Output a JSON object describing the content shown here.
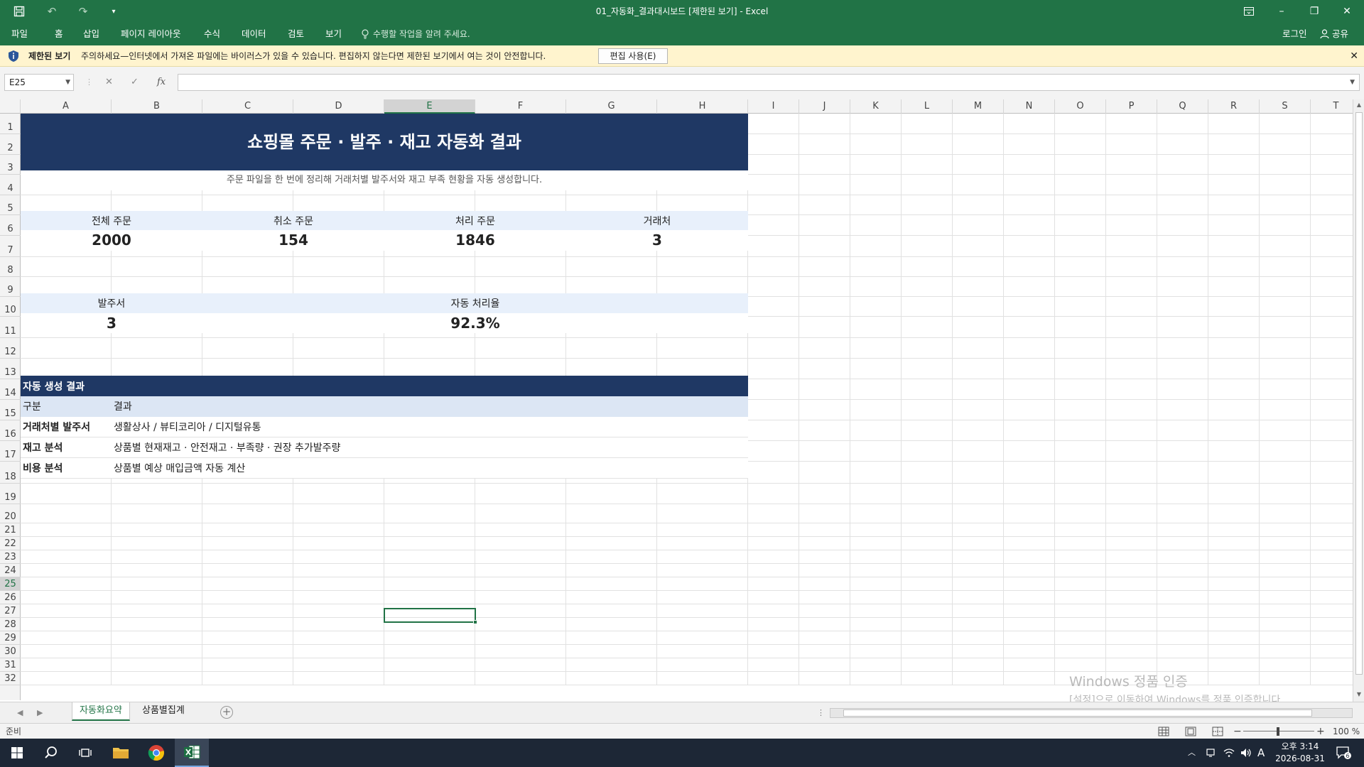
{
  "window": {
    "title": "01_자동화_결과대시보드  [제한된 보기] - Excel",
    "minimize": "–",
    "restore": "❐",
    "close": "✕"
  },
  "menu": {
    "items": [
      "파일",
      "홈",
      "삽입",
      "페이지 레이아웃",
      "수식",
      "데이터",
      "검토",
      "보기"
    ],
    "tell_me": "수행할 작업을 알려 주세요.",
    "login": "로그인",
    "share": "공유"
  },
  "protected_view": {
    "title": "제한된 보기",
    "message": "주의하세요—인터넷에서 가져온 파일에는 바이러스가 있을 수 있습니다. 편집하지 않는다면 제한된 보기에서 여는 것이 안전합니다.",
    "button": "편집 사용(E)",
    "close": "✕"
  },
  "formula_bar": {
    "name_box": "E25",
    "cancel": "✕",
    "enter": "✓",
    "fx": "fx",
    "value": ""
  },
  "columns": [
    "A",
    "B",
    "C",
    "D",
    "E",
    "F",
    "G",
    "H",
    "I",
    "J",
    "K",
    "L",
    "M",
    "N",
    "O",
    "P",
    "Q",
    "R",
    "S",
    "T"
  ],
  "selected_column": "E",
  "selected_row": "25",
  "rows": [
    "1",
    "2",
    "3",
    "4",
    "5",
    "6",
    "7",
    "8",
    "9",
    "10",
    "11",
    "12",
    "13",
    "14",
    "15",
    "16",
    "17",
    "18",
    "19",
    "20",
    "21",
    "22",
    "23",
    "24",
    "25",
    "26",
    "27",
    "28",
    "29",
    "30",
    "31",
    "32"
  ],
  "sheet": {
    "title": "쇼핑몰 주문 · 발주 · 재고 자동화 결과",
    "subtitle": "주문 파일을 한 번에 정리해 거래처별 발주서와 재고 부족 현황을 자동 생성합니다.",
    "kpis_row1": [
      {
        "label": "전체 주문",
        "value": "2000"
      },
      {
        "label": "취소 주문",
        "value": "154"
      },
      {
        "label": "처리 주문",
        "value": "1846"
      },
      {
        "label": "거래처",
        "value": "3"
      }
    ],
    "kpis_row2": [
      {
        "label": "발주서",
        "value": "3"
      },
      {
        "label": "자동 처리율",
        "value": "92.3%"
      }
    ],
    "section_title": "자동 생성 결과",
    "table_headers": [
      "구분",
      "결과"
    ],
    "table_rows": [
      {
        "category": "거래처별 발주서",
        "result": "생활상사 / 뷰티코리아 / 디지털유통"
      },
      {
        "category": "재고 분석",
        "result": "상품별 현재재고 · 안전재고 · 부족량 · 권장 추가발주량"
      },
      {
        "category": "비용 분석",
        "result": "상품별 예상 매입금액 자동 계산"
      }
    ]
  },
  "watermark": {
    "line1": "Windows 정품 인증",
    "line2": "[설정]으로 이동하여 Windows를 정품 인증합니다."
  },
  "sheet_tabs": [
    "자동화요약",
    "상품별집계"
  ],
  "add_sheet": "+",
  "status": {
    "ready": "준비",
    "zoom": "100 %"
  },
  "taskbar": {
    "time": "오후 3:14",
    "date": "2026-08-31",
    "ime": "A",
    "notifications": "6"
  },
  "colors": {
    "excel_green": "#217346",
    "banner_navy": "#1f3864",
    "kpi_label_bg": "#e8f0fb",
    "table_header_bg": "#dce6f4",
    "protected_bar_bg": "#fff4ce"
  }
}
